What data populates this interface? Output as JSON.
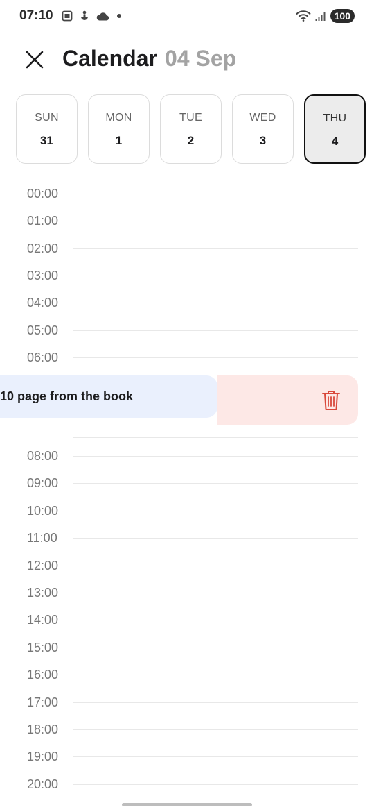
{
  "status_bar": {
    "time": "07:10",
    "battery": "100",
    "icons_left": [
      "screenshot-icon",
      "accessibility-icon",
      "cloud-icon",
      "dot-icon"
    ],
    "icons_right": [
      "wifi-icon",
      "signal-icon",
      "battery-icon"
    ]
  },
  "header": {
    "title": "Calendar",
    "date": "04 Sep",
    "close_icon": "close-icon"
  },
  "days": [
    {
      "name": "SUN",
      "num": "31",
      "selected": false
    },
    {
      "name": "MON",
      "num": "1",
      "selected": false
    },
    {
      "name": "TUE",
      "num": "2",
      "selected": false
    },
    {
      "name": "WED",
      "num": "3",
      "selected": false
    },
    {
      "name": "THU",
      "num": "4",
      "selected": true
    }
  ],
  "hours_before": [
    "00:00",
    "01:00",
    "02:00",
    "03:00",
    "04:00",
    "05:00",
    "06:00"
  ],
  "hours_after": [
    "08:00",
    "09:00",
    "10:00",
    "11:00",
    "12:00",
    "13:00",
    "14:00",
    "15:00",
    "16:00",
    "17:00",
    "18:00",
    "19:00",
    "20:00"
  ],
  "event": {
    "title": "10 page from the book",
    "delete_icon": "trash-icon",
    "colors": {
      "event_bg": "#eaf0fd",
      "delete_bg": "#fde8e6",
      "delete_icon": "#d9483b"
    }
  }
}
